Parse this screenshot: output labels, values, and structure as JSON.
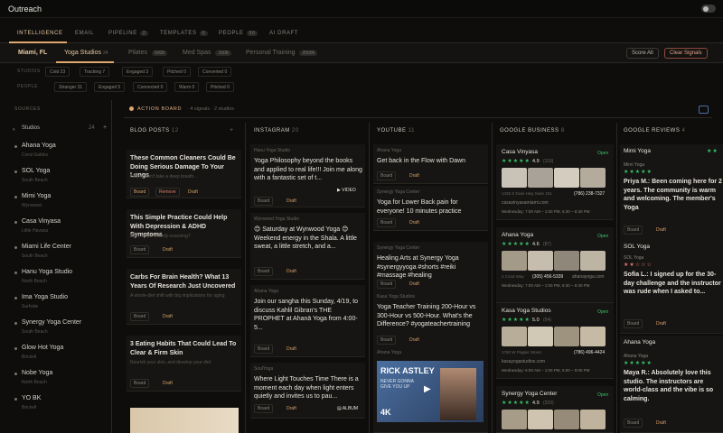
{
  "app": {
    "title": "Outreach"
  },
  "nav": {
    "tabs": [
      "INTELLIGENCE",
      "EMAIL",
      "PIPELINE",
      "TEMPLATES",
      "PEOPLE",
      "AI DRAFT"
    ],
    "badges": {
      "pipeline": "2",
      "templates": "0",
      "people": "50"
    }
  },
  "subnav": {
    "location": "Miami, FL",
    "tabs": [
      "Yoga Studios",
      "Pilates",
      "Med Spas",
      "Personal Training"
    ],
    "counts": [
      "24",
      "5008",
      "1508",
      "25006"
    ],
    "score_all": "Score All",
    "clear_signals": "Clear Signals"
  },
  "filters": {
    "studios_label": "STUDIOS",
    "studios": [
      "Cold 23",
      "Tracking 7",
      "Engaged 3",
      "Pitched 0",
      "Converted 0"
    ],
    "people_label": "PEOPLE",
    "people": [
      "Stranger 31",
      "Engaged 5",
      "Connected 0",
      "Warm 0",
      "Pitched 0"
    ]
  },
  "sidebar": {
    "title": "SOURCES",
    "section": "Studios",
    "count": "24",
    "items": [
      {
        "name": "Ahana Yoga",
        "sub": "Coral Gables"
      },
      {
        "name": "SOL Yoga",
        "sub": "South Beach"
      },
      {
        "name": "Mimi Yoga",
        "sub": "Wynwood"
      },
      {
        "name": "Casa Vinyasa",
        "sub": "Little Havana"
      },
      {
        "name": "Miami Life Center",
        "sub": "South Beach"
      },
      {
        "name": "Hanu Yoga Studio",
        "sub": "North Beach"
      },
      {
        "name": "Ima Yoga Studio",
        "sub": "Surfside"
      },
      {
        "name": "Synergy Yoga Center",
        "sub": "South Beach"
      },
      {
        "name": "Glow Hot Yoga",
        "sub": "Brickell"
      },
      {
        "name": "Nobe Yoga",
        "sub": "North Beach"
      },
      {
        "name": "YO BK",
        "sub": "Brickell"
      }
    ]
  },
  "board": {
    "title": "ACTION BOARD",
    "meta": "· 4 signals · 2 studios"
  },
  "columns": {
    "blog": {
      "head": "BLOG POSTS",
      "count": "12",
      "cards": [
        {
          "title": "These Common Cleaners Could Be Doing Serious Damage To Your Lungs",
          "sub": "Maybe don't take a deep breath...",
          "actions": [
            "Board",
            "Remove",
            "Draft"
          ]
        },
        {
          "title": "This Simple Practice Could Help With Depression & ADHD Symptoms",
          "sub": "Ever heard of body-scanning?",
          "actions": [
            "Board",
            "Draft"
          ]
        },
        {
          "title": "Carbs For Brain Health? What 13 Years Of Research Just Uncovered",
          "sub": "A whole-diet shift with big implications for aging",
          "actions": [
            "Board",
            "Draft"
          ]
        },
        {
          "title": "3 Eating Habits That Could Lead To Clear & Firm Skin",
          "sub": "Nourish your skin, and develop your diet",
          "actions": [
            "Board",
            "Draft"
          ]
        }
      ]
    },
    "instagram": {
      "head": "INSTAGRAM",
      "count": "20",
      "cards": [
        {
          "meta": "Hanu Yoga Studio",
          "title": "Yoga Philosophy beyond the books and applied to real life!!! Join me along with a fantastic set of t...",
          "tag": "VIDEO",
          "actions": [
            "Board",
            "Draft"
          ]
        },
        {
          "meta": "Wynwood Yoga Studio",
          "title": "😊 Saturday at Wynwood Yoga 😊 Weekend energy in the Shala. A little sweat, a little stretch, and a...",
          "actions": [
            "Board",
            "Draft"
          ]
        },
        {
          "meta": "Ahana Yoga",
          "title": "Join our sangha this Sunday, 4/19, to discuss Kahlil Gibran's THE PROPHET at Ahanā Yoga from 4:00-5...",
          "actions": [
            "Board",
            "Draft"
          ]
        },
        {
          "meta": "SoulYoga",
          "title": "Where Light Touches Time There is a moment each day when light enters quietly and invites us to pau...",
          "tag": "ALBUM",
          "actions": [
            "Board",
            "Draft"
          ]
        }
      ]
    },
    "youtube": {
      "head": "YOUTUBE",
      "count": "11",
      "cards": [
        {
          "meta": "Ahana Yoga",
          "title": "Get back in the Flow with Dawn",
          "actions": [
            "Board",
            "Draft"
          ]
        },
        {
          "meta": "Synergy Yoga Center",
          "title": "Yoga for Lower Back pain for everyone! 10 minutes practice",
          "actions": [
            "Board",
            "Draft"
          ]
        },
        {
          "meta": "Synergy Yoga Center",
          "title": "Healing Arts at Synergy Yoga #synergyyoga #shorts #reiki #massage #healing",
          "actions": [
            "Board",
            "Draft"
          ]
        },
        {
          "meta": "Kasa Yoga Studios",
          "title": "Yoga Teacher Training 200-Hour vs 300-Hour vs 500-Hour. What's the Difference? #yogateachertraining",
          "actions": [
            "Board",
            "Draft"
          ]
        },
        {
          "meta": "Ahana Yoga",
          "video_title": "RICK ASTLEY",
          "video_sub": "NEVER GONNA GIVE YOU UP",
          "video_q": "4K"
        }
      ]
    },
    "gbiz": {
      "head": "GOOGLE BUSINESS",
      "count": "8",
      "cards": [
        {
          "name": "Casa Vinyasa",
          "rating": "4.9",
          "reviews": "(119)",
          "open": "Open",
          "addr": "1435 S Dixie Hwy Suite 101",
          "phone": "(786) 238-7327",
          "site": "casavinyasamiami.com",
          "hours": "Wednesday: 7:00 AM – 1:00 PM, 5:30 – 8:30 PM"
        },
        {
          "name": "Ahana Yoga",
          "rating": "4.6",
          "reviews": "(87)",
          "open": "Open",
          "addr": "2 Coral Way",
          "phone": "(305) 456-5339",
          "site": "ahanayoga.com",
          "hours": "Wednesday: 7:00 AM – 1:00 PM, 5:30 – 8:30 PM"
        },
        {
          "name": "Kasa Yoga Studios",
          "rating": "5.0",
          "reviews": "(54)",
          "open": "Open",
          "addr": "1760 W Flagler Street",
          "phone": "(786) 496-4424",
          "site": "kasayogastudios.com",
          "hours": "Wednesday: 6:00 AM – 1:00 PM, 5:00 – 9:00 PM"
        },
        {
          "name": "Synergy Yoga Center",
          "rating": "4.9",
          "reviews": "(203)",
          "open": "Open"
        }
      ]
    },
    "greviews": {
      "head": "GOOGLE REVIEWS",
      "count": "4",
      "cards": [
        {
          "name": "Mimi Yoga",
          "author": "Mimi Yoga",
          "text": "Priya M.: Been coming here for 2 years. The community is warm and welcoming. The member's Yoga",
          "fade": "Been coming here for 2 years. The community is warm and welcoming. The member's Yoga",
          "actions": [
            "Board",
            "Draft"
          ]
        },
        {
          "name": "SOL Yoga",
          "author": "SOL Yoga",
          "text": "Sofia L.: I signed up for the 30-day challenge and the instructor was rude when I asked to...",
          "fade": "I signed up for the 30-day challenge and the instructor was rude when I asked to...",
          "actions": [
            "Board",
            "Draft"
          ]
        },
        {
          "name": "Ahana Yoga",
          "author": "Ahana Yoga",
          "text": "Maya R.: Absolutely love this studio. The instructors are world-class and the vibe is so calming.",
          "fade": "Absolutely love this studio. The instructors are world-class and the vibe is so calming.",
          "actions": [
            "Board",
            "Draft"
          ]
        }
      ]
    }
  },
  "colors": {
    "accent": "#e0a86e",
    "green": "#37c467",
    "bg": "#0e0d0c"
  }
}
